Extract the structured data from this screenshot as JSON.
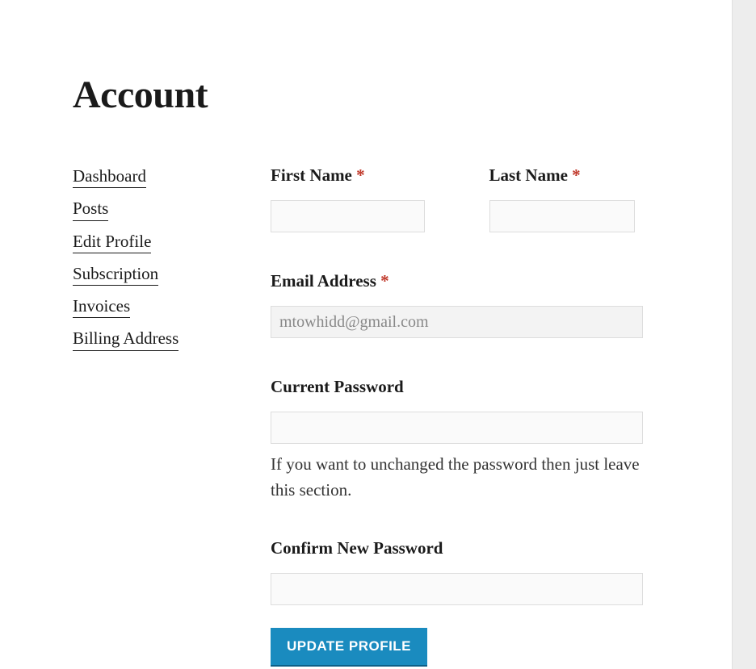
{
  "page": {
    "title": "Account"
  },
  "sidebar": {
    "items": [
      {
        "label": "Dashboard"
      },
      {
        "label": "Posts"
      },
      {
        "label": "Edit Profile"
      },
      {
        "label": "Subscription"
      },
      {
        "label": "Invoices"
      },
      {
        "label": "Billing Address"
      }
    ]
  },
  "form": {
    "first_name": {
      "label": "First Name",
      "required": "*",
      "value": ""
    },
    "last_name": {
      "label": "Last Name",
      "required": "*",
      "value": ""
    },
    "email": {
      "label": "Email Address",
      "required": "*",
      "value": "mtowhidd@gmail.com"
    },
    "current_password": {
      "label": "Current Password",
      "value": "",
      "help": "If you want to unchanged the password then just leave this section."
    },
    "confirm_password": {
      "label": "Confirm New Password",
      "value": ""
    },
    "submit_label": "UPDATE PROFILE"
  }
}
